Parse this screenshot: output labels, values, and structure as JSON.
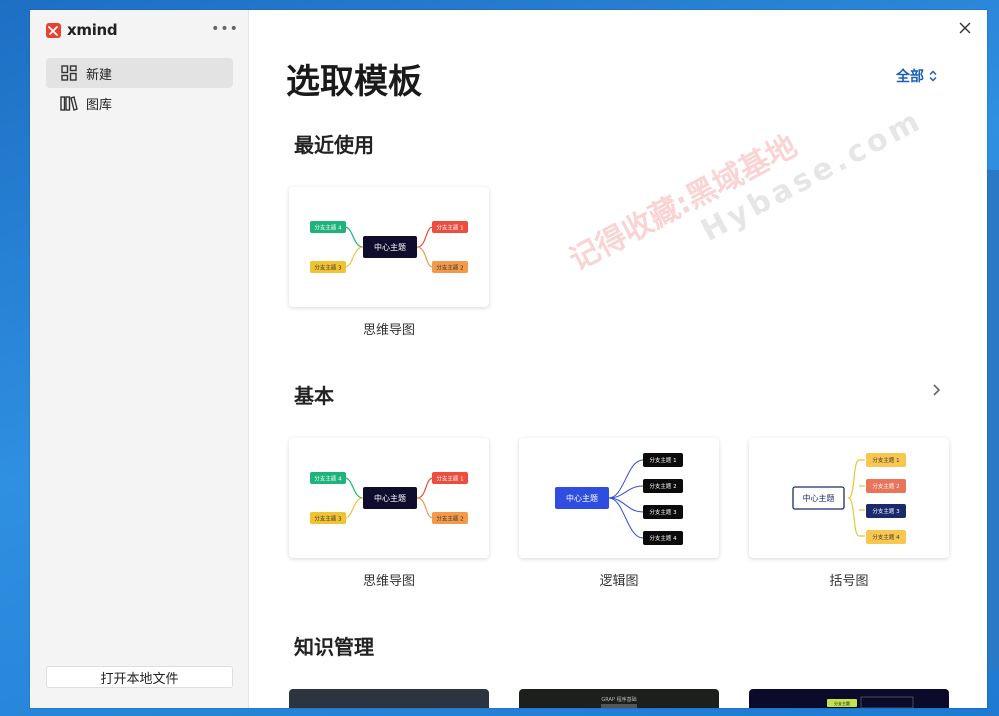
{
  "app": {
    "brand": "xmind"
  },
  "sidebar": {
    "items": [
      {
        "label": "新建",
        "icon": "grid-icon"
      },
      {
        "label": "图库",
        "icon": "library-icon"
      }
    ],
    "open_local": "打开本地文件"
  },
  "main": {
    "title": "选取模板",
    "filter": "全部",
    "sections": {
      "recent": "最近使用",
      "basic": "基本",
      "knowledge": "知识管理"
    },
    "templates": {
      "mindmap": "思维导图",
      "logic": "逻辑图",
      "bracket": "括号图"
    }
  },
  "diagram_text": {
    "center": "中心主题",
    "b1": "分支主题 1",
    "b2": "分支主题 2",
    "b3": "分支主题 3",
    "b4": "分支主题 4"
  },
  "thumb": {
    "k2_title": "GRAP 程序基础",
    "k3_tag": "分支主题"
  },
  "watermark": {
    "line1": "记得收藏:黑域基地",
    "line2": "Hybase.com"
  },
  "colors": {
    "accent": "#1b5fb8",
    "logo": "#e7412f",
    "center_dark": "#0f0c2e",
    "logic_center": "#2f4de0"
  }
}
